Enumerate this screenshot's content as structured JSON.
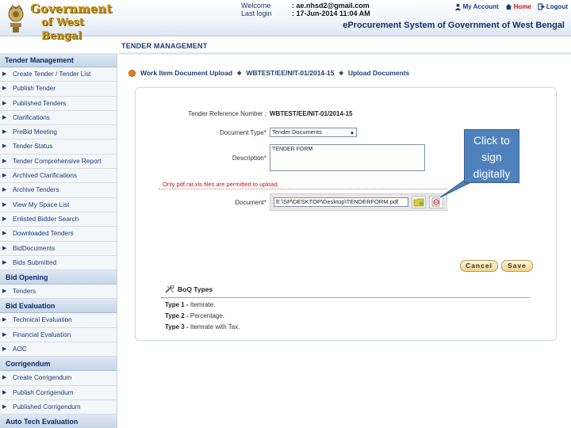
{
  "header": {
    "logo_line1": "Government",
    "logo_line2": "of West Bengal",
    "welcome_label": "Welcome",
    "welcome_value": ": ae.nhsd2@gmail.com",
    "last_login_label": "Last login",
    "last_login_value": ": 17-Jun-2014 11:04 AM",
    "my_account": "My Account",
    "home": "Home",
    "logout": "Logout",
    "system_title": "eProcurement System of Government of West Bengal"
  },
  "page": {
    "title": "TENDER MANAGEMENT",
    "breadcrumb": [
      "Work Item Document Upload",
      "WBTEST/EE/NIT-01/2014-15",
      "Upload Documents"
    ]
  },
  "sidebar": {
    "sections": [
      {
        "title": "Tender Management",
        "items": [
          "Create Tender / Tender List",
          "Publish Tender",
          "Published Tenders",
          "Clarifications",
          "PreBid Meeting",
          "Tender Status",
          "Tender Comprehensive Report",
          "Archived Clarifications",
          "Archive Tenders",
          "View My Space List",
          "Enlisted Bidder Search",
          "Downloaded Tenders",
          "BidDocuments",
          "Bids Submitted"
        ]
      },
      {
        "title": "Bid Opening",
        "items": [
          "Tenders"
        ]
      },
      {
        "title": "Bid Evaluation",
        "items": [
          "Technical Evaluation",
          "Financial Evaluation",
          "AOC"
        ]
      },
      {
        "title": "Corrigendum",
        "items": [
          "Create Corrigendum",
          "Publish Corrigendum",
          "Published Corrigendum"
        ]
      },
      {
        "title": "Auto Tech Evaluation",
        "items": []
      }
    ]
  },
  "form": {
    "ref_label": "Tender Reference Number :",
    "ref_value": "WBTEST/EE/NIT-01/2014-15",
    "doc_type_label": "Document Type",
    "doc_type_value": "Tender Documents",
    "description_label": "Description",
    "description_value": "TENDER FORM",
    "note": "Only pdf,rar,xls files are permitted to upload.",
    "document_label": "Document",
    "document_value": "E:\\SP\\DESKTOP\\Desktop\\TENDERFORM.pdf",
    "required_mark": "*",
    "cancel": "Cancel",
    "save": "Save"
  },
  "boq": {
    "title": "BoQ Types",
    "types": [
      {
        "label": "Type 1 -",
        "desc": "Itemrate."
      },
      {
        "label": "Type 2 -",
        "desc": "Percentage."
      },
      {
        "label": "Type 3 -",
        "desc": "Itemrate with Tax."
      }
    ]
  },
  "callout": {
    "text": "Click to sign digitally"
  },
  "colors": {
    "accent": "#1d3c73",
    "callout": "#4f81bd",
    "note": "#cc1111"
  }
}
